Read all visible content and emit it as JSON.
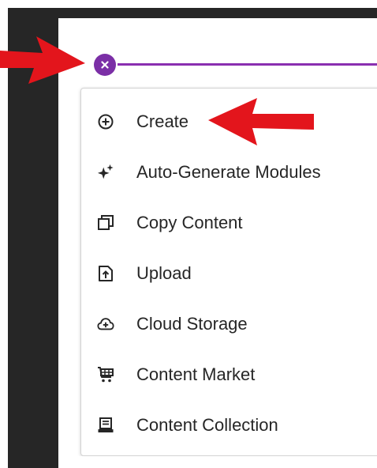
{
  "close_button": {
    "icon": "close-icon",
    "color": "#7b2fa6"
  },
  "menu": {
    "items": [
      {
        "label": "Create",
        "icon": "plus-circle-icon"
      },
      {
        "label": "Auto-Generate Modules",
        "icon": "sparkle-icon"
      },
      {
        "label": "Copy Content",
        "icon": "copy-icon"
      },
      {
        "label": "Upload",
        "icon": "upload-icon"
      },
      {
        "label": "Cloud Storage",
        "icon": "cloud-plus-icon"
      },
      {
        "label": "Content Market",
        "icon": "cart-icon"
      },
      {
        "label": "Content Collection",
        "icon": "collection-icon"
      }
    ]
  },
  "colors": {
    "accent": "#7b2fa6",
    "arrow": "#e3151c",
    "panel": "#262626"
  }
}
